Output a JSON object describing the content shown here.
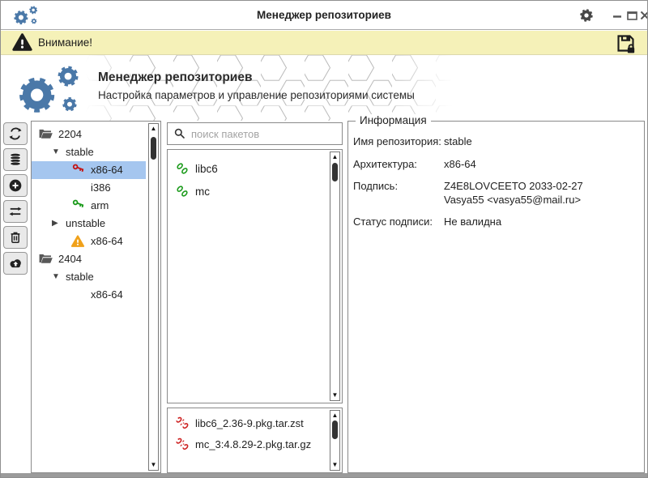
{
  "colors": {
    "accent_blue": "#4a78a8",
    "selection_blue": "#a5c6ef",
    "banner_bg": "#f5f1b8",
    "key_red": "#c41414",
    "key_green": "#1a9a1a",
    "warning_orange": "#f0a11a",
    "chain_green": "#1a9a1a",
    "chain_broken_red": "#cd2020",
    "icon_dark": "#222222"
  },
  "titlebar": {
    "title": "Менеджер репозиториев",
    "icons": [
      "app-gears",
      "settings-gear",
      "minimize",
      "maximize",
      "close"
    ]
  },
  "banner": {
    "text": "Внимание!",
    "icons": [
      "warning-triangle",
      "save-signature"
    ]
  },
  "header": {
    "title": "Менеджер репозиториев",
    "subtitle": "Настройка параметров и управление репозиториями системы"
  },
  "toolbar": {
    "buttons": [
      "refresh",
      "database",
      "add",
      "sync",
      "delete",
      "upload"
    ]
  },
  "tree": {
    "items": [
      {
        "depth": 0,
        "icon": "folder-open",
        "expander": null,
        "label": "2204",
        "selected": false
      },
      {
        "depth": 1,
        "icon": null,
        "expander": "expanded",
        "label": "stable",
        "selected": false
      },
      {
        "depth": 2,
        "icon": "key-red",
        "expander": null,
        "label": "x86-64",
        "selected": true
      },
      {
        "depth": 2,
        "icon": null,
        "expander": null,
        "label": "i386",
        "selected": false
      },
      {
        "depth": 2,
        "icon": "key-green",
        "expander": null,
        "label": "arm",
        "selected": false
      },
      {
        "depth": 1,
        "icon": null,
        "expander": "collapsed",
        "label": "unstable",
        "selected": false
      },
      {
        "depth": 2,
        "icon": "warning",
        "expander": null,
        "label": "x86-64",
        "selected": false
      },
      {
        "depth": 0,
        "icon": "folder-open",
        "expander": null,
        "label": "2404",
        "selected": false
      },
      {
        "depth": 1,
        "icon": null,
        "expander": "expanded",
        "label": "stable",
        "selected": false
      },
      {
        "depth": 2,
        "icon": null,
        "expander": null,
        "label": "x86-64",
        "selected": false
      }
    ]
  },
  "packages": {
    "search_placeholder": "поиск пакетов",
    "items": [
      {
        "icon": "chain-linked",
        "label": "libc6"
      },
      {
        "icon": "chain-linked",
        "label": "mc"
      }
    ]
  },
  "files": {
    "items": [
      {
        "icon": "chain-broken",
        "label": "libc6_2.36-9.pkg.tar.zst"
      },
      {
        "icon": "chain-broken",
        "label": "mc_3:4.8.29-2.pkg.tar.gz"
      }
    ]
  },
  "info": {
    "legend": "Информация",
    "fields": [
      {
        "label": "Имя репозитория:",
        "value": "stable"
      },
      {
        "label": "Архитектура:",
        "value": "x86-64"
      },
      {
        "label": "Подпись:",
        "value": "Z4E8LOVCEETO 2033-02-27\nVasya55 <vasya55@mail.ru>"
      },
      {
        "label": "Статус подписи:",
        "value": "Не валидна"
      }
    ]
  }
}
